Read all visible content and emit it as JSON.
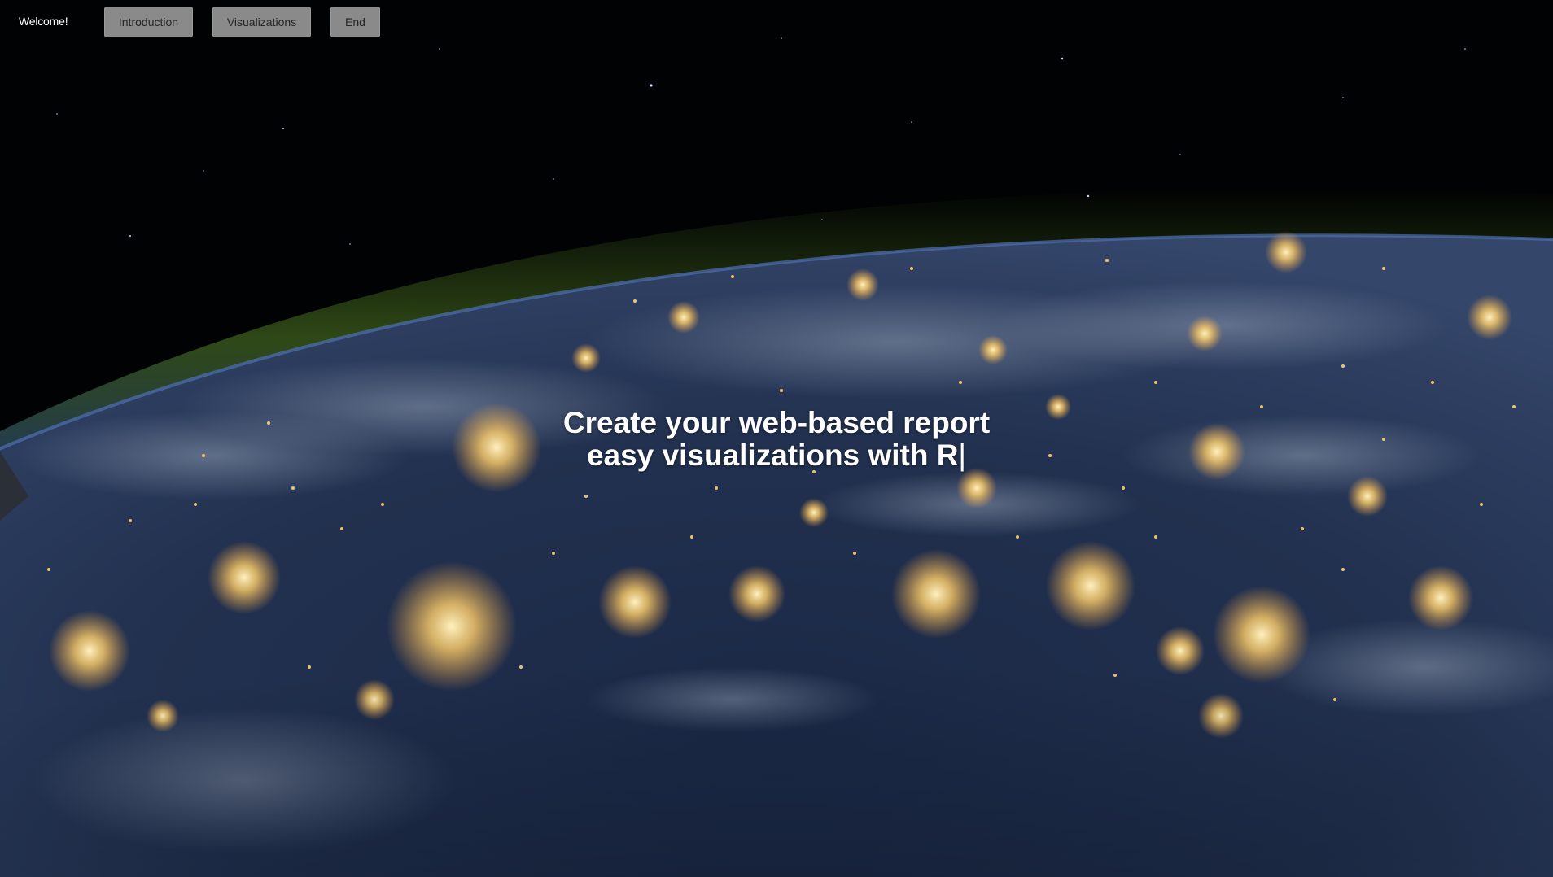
{
  "nav": {
    "brand": "Welcome!",
    "buttons": [
      {
        "label": "Introduction"
      },
      {
        "label": "Visualizations"
      },
      {
        "label": "End"
      }
    ]
  },
  "hero": {
    "line1": "Create your web-based report",
    "line2": "easy visualizations with R",
    "cursor": "|"
  },
  "background": {
    "subject": "earth-at-night-from-orbit",
    "space_color": "#010203",
    "ocean_color": "#1c2c48",
    "atmosphere_color": "#3a5a1c",
    "city_light_color": "#ffd27a"
  }
}
